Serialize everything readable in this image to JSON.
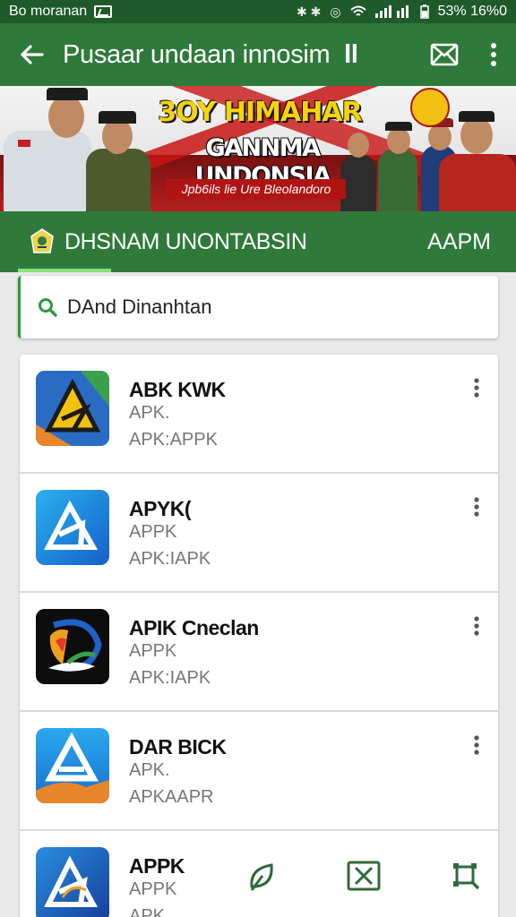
{
  "status_bar": {
    "carrier": "Bo moranan",
    "right_text": "53% 16%0",
    "colors": {
      "background": "#1f5a2a"
    }
  },
  "app_bar": {
    "title": "Pusaar undaan innosim",
    "title_suffix": "ll",
    "back_icon": "arrow-left-icon",
    "mail_icon": "mail-icon",
    "more_icon": "more-vert-icon",
    "color": "#2f7a3b"
  },
  "banner": {
    "headline": "3OY HIMAHAR",
    "subheadline": "GANNMA UNDONSIA",
    "tagline": "Jpb6ils lie Ure Bleolandoro"
  },
  "category_bar": {
    "label": "DHSNAM UNONTABSIN",
    "right_label": "AAPM"
  },
  "search": {
    "placeholder": "DAnd Dinanhtan"
  },
  "apps": [
    {
      "title": "ABK KWK",
      "sub1": "APK.",
      "sub2": "APK:APPK",
      "icon": "triangle-a-yellow-icon"
    },
    {
      "title": "APYK(",
      "sub1": "APPK",
      "sub2": "APK:IAPK",
      "icon": "triangle-a-blue-icon"
    },
    {
      "title": "APIK Cneclan",
      "sub1": "APPK",
      "sub2": "APK:IAPK",
      "icon": "bird-swirl-icon"
    },
    {
      "title": "DAR BICK",
      "sub1": "APK.",
      "sub2": "APKAAPR",
      "icon": "triangle-a-orange-icon"
    },
    {
      "title": "APPK",
      "sub1": "APPK",
      "sub2": "APK",
      "icon": "triangle-a-navy-icon"
    }
  ],
  "bottom_actions": [
    {
      "name": "leaf-icon"
    },
    {
      "name": "close-box-icon"
    },
    {
      "name": "crop-select-icon"
    }
  ]
}
